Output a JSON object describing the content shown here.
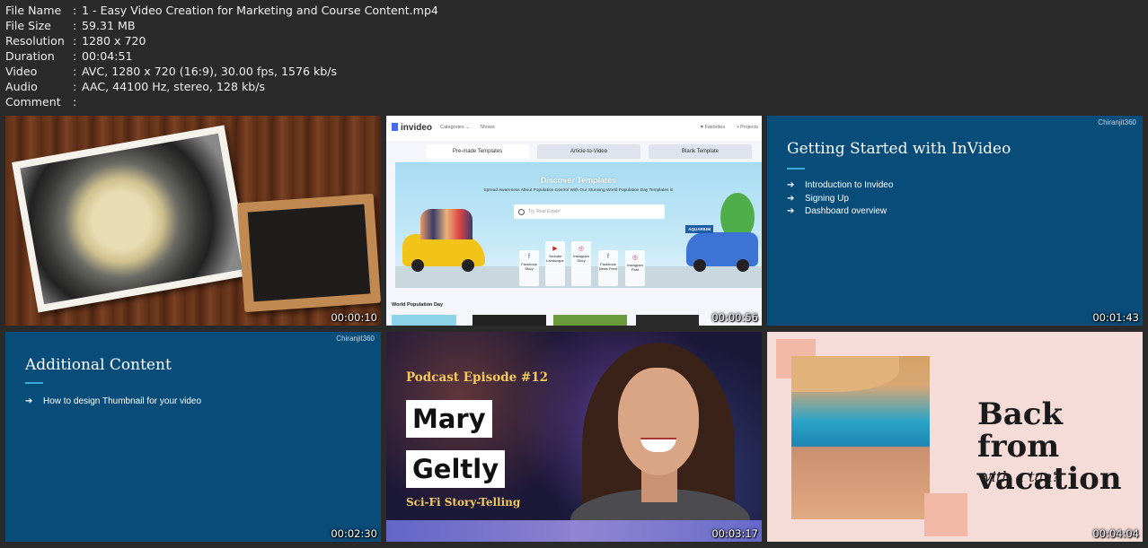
{
  "file_info": [
    {
      "key": "File Name",
      "value": "1 - Easy Video Creation for Marketing and Course Content.mp4"
    },
    {
      "key": "File Size",
      "value": "59.31 MB"
    },
    {
      "key": "Resolution",
      "value": "1280 x 720"
    },
    {
      "key": "Duration",
      "value": "00:04:51"
    },
    {
      "key": "Video",
      "value": "AVC, 1280 x 720 (16:9), 30.00 fps, 1576 kb/s"
    },
    {
      "key": "Audio",
      "value": "AAC, 44100 Hz, stereo, 128 kb/s"
    },
    {
      "key": "Comment",
      "value": ""
    }
  ],
  "separator": ":",
  "thumbnails": [
    {
      "timestamp": "00:00:10"
    },
    {
      "timestamp": "00:00:56",
      "logo": "invideo",
      "nav": [
        "Categories ⌄",
        "Shows"
      ],
      "nav_right": [
        "♥ Favorites",
        "▪ Projects"
      ],
      "tabs": [
        "Pre-made Templates",
        "Article-to-Video",
        "Blank Template"
      ],
      "banner_title": "Discover Templates",
      "banner_subtitle": "Spread Awareness About Population Control With Our Stunning World Population Day Templates in",
      "search_placeholder": "Try 'Real Estate'",
      "cards": [
        {
          "icon": "f",
          "label": "Facebook Story"
        },
        {
          "icon": "▶",
          "label": "Youtube Landscape"
        },
        {
          "icon": "◎",
          "label": "Instagram Story"
        },
        {
          "icon": "f",
          "label": "Facebook News Feed"
        },
        {
          "icon": "◎",
          "label": "Instagram Post"
        }
      ],
      "badge": "AQUARIUM",
      "section": "World Population Day"
    },
    {
      "timestamp": "00:01:43",
      "brand": "Chiranjit360",
      "title": "Getting Started with InVideo",
      "arrow": "➔",
      "bullets": [
        "Introduction to Invideo",
        "Signing Up",
        "Dashboard overview"
      ]
    },
    {
      "timestamp": "00:02:30",
      "brand": "Chiranjit360",
      "title": "Additional Content",
      "arrow": "➔",
      "bullets": [
        "How to design Thumbnail for your video"
      ]
    },
    {
      "timestamp": "00:03:17",
      "episode": "Podcast Episode #12",
      "first_name": "Mary",
      "last_name": "Geltly",
      "tagline": "Sci-Fi Story-Telling"
    },
    {
      "timestamp": "00:04:04",
      "title_line1": "Back from",
      "title_line2": "vacation",
      "subtitle": "with a tan?"
    }
  ]
}
